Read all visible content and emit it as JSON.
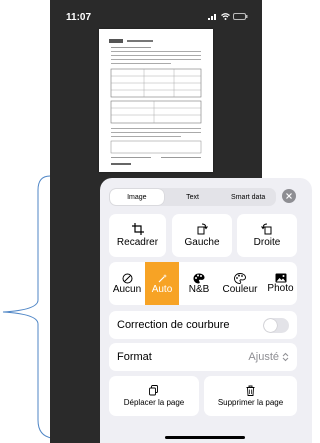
{
  "status": {
    "time": "11:07"
  },
  "tabs": [
    {
      "label": "Image",
      "active": true
    },
    {
      "label": "Text",
      "active": false
    },
    {
      "label": "Smart data",
      "active": false
    }
  ],
  "tools": {
    "crop": "Recadrer",
    "rotate_left": "Gauche",
    "rotate_right": "Droite"
  },
  "filters": [
    {
      "label": "Aucun",
      "icon": "no-filter-icon",
      "selected": false
    },
    {
      "label": "Auto",
      "icon": "magic-wand-icon",
      "selected": true
    },
    {
      "label": "N&B",
      "icon": "palette-icon",
      "selected": false
    },
    {
      "label": "Couleur",
      "icon": "palette-outline-icon",
      "selected": false
    },
    {
      "label": "Photo",
      "icon": "photo-icon",
      "selected": false
    }
  ],
  "curve_correction": {
    "label": "Correction de courbure",
    "enabled": false
  },
  "format": {
    "label": "Format",
    "value": "Ajusté"
  },
  "page_actions": {
    "move": "Déplacer la page",
    "delete": "Supprimer la page"
  },
  "colors": {
    "accent": "#f7a325",
    "panel_bg": "#efeff4",
    "card_bg": "#ffffff",
    "dark_bg": "#2a2a2a",
    "bracket": "#4f86c6"
  }
}
